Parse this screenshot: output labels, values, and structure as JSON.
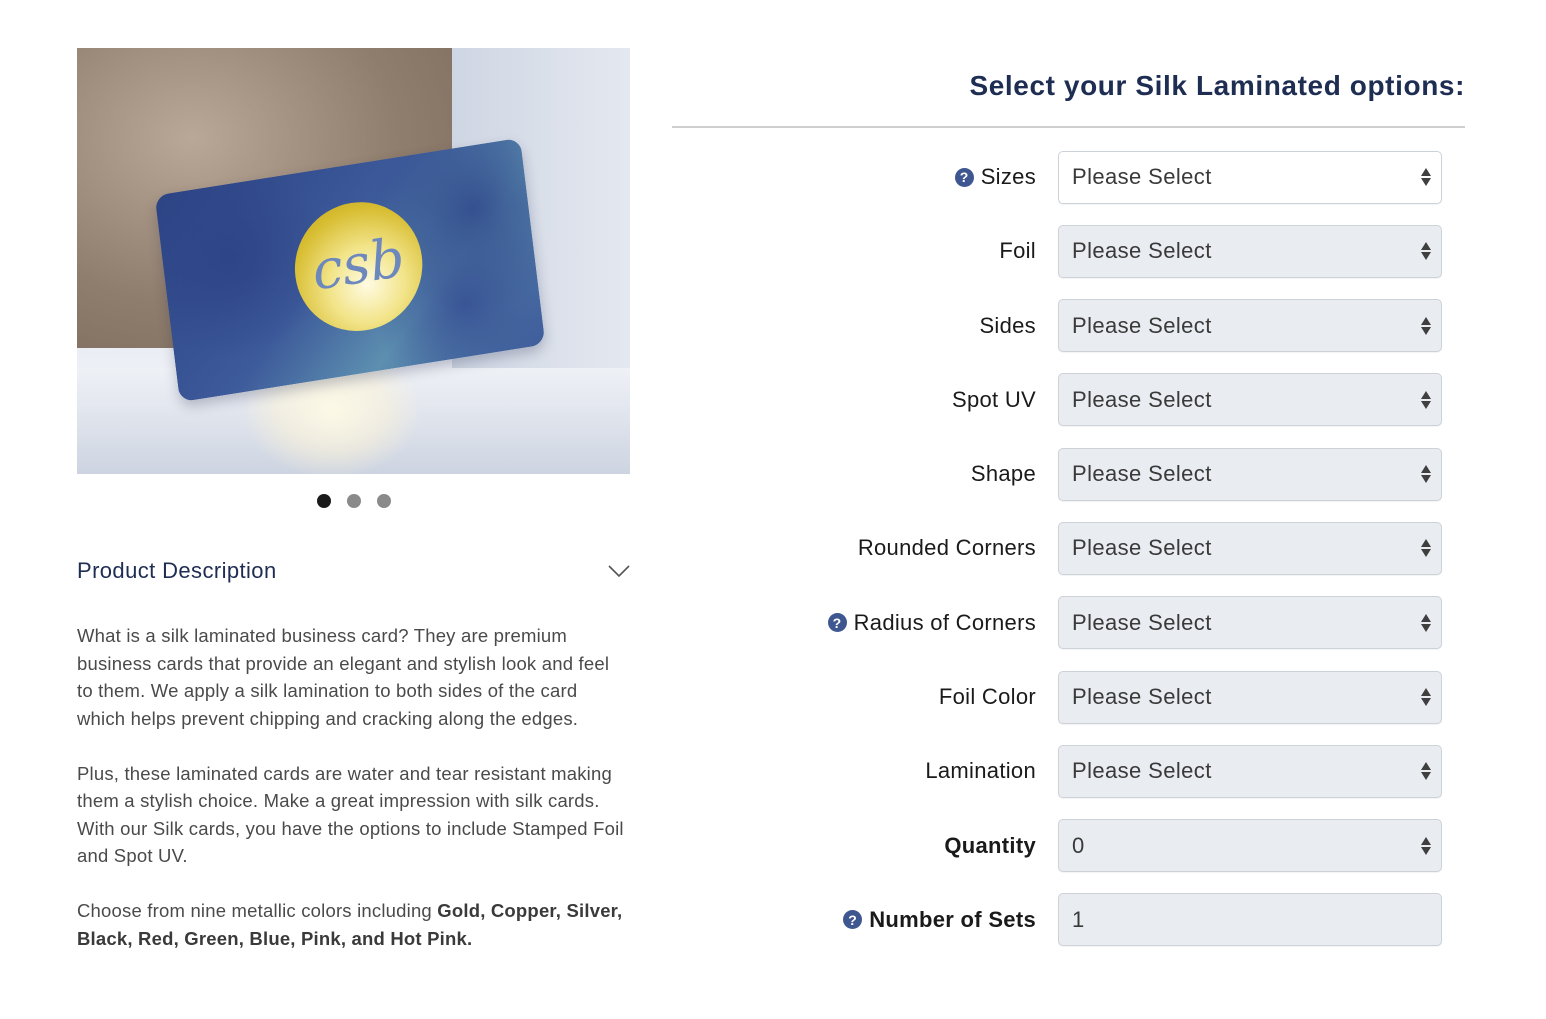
{
  "gallery": {
    "image_alt": "Silk laminated business card with gold foil monogram leaning against a stone pot",
    "monogram": "csb",
    "slide_count": 3,
    "active_slide": 1
  },
  "description": {
    "title": "Product Description",
    "expand_icon": "chevron-down-icon",
    "paragraph1": "What is a silk laminated business card? They are premium business cards that provide an elegant and stylish look and feel to them. We apply a silk lamination to both sides of the card which helps prevent chipping and cracking along the edges.",
    "paragraph2": "Plus, these laminated cards are water and tear resistant making them a stylish choice. Make a great impression with silk cards. With our Silk cards, you have the options to include Stamped Foil and Spot UV.",
    "paragraph3_prefix": "Choose from nine metallic colors including ",
    "paragraph3_bold": "Gold, Copper, Silver, Black, Red, Green, Blue, Pink, and Hot Pink."
  },
  "options": {
    "title": "Select your Silk Laminated options:",
    "help_glyph": "?",
    "fields": [
      {
        "label": "Sizes",
        "value": "Please Select",
        "help": true,
        "bold": false,
        "type": "select"
      },
      {
        "label": "Foil",
        "value": "Please Select",
        "help": false,
        "bold": false,
        "type": "select"
      },
      {
        "label": "Sides",
        "value": "Please Select",
        "help": false,
        "bold": false,
        "type": "select"
      },
      {
        "label": "Spot UV",
        "value": "Please Select",
        "help": false,
        "bold": false,
        "type": "select"
      },
      {
        "label": "Shape",
        "value": "Please Select",
        "help": false,
        "bold": false,
        "type": "select"
      },
      {
        "label": "Rounded Corners",
        "value": "Please Select",
        "help": false,
        "bold": false,
        "type": "select"
      },
      {
        "label": "Radius of Corners",
        "value": "Please Select",
        "help": true,
        "bold": false,
        "type": "select"
      },
      {
        "label": "Foil Color",
        "value": "Please Select",
        "help": false,
        "bold": false,
        "type": "select"
      },
      {
        "label": "Lamination",
        "value": "Please Select",
        "help": false,
        "bold": false,
        "type": "select"
      },
      {
        "label": "Quantity",
        "value": "0",
        "help": false,
        "bold": true,
        "type": "select"
      },
      {
        "label": "Number of Sets",
        "value": "1",
        "help": true,
        "bold": true,
        "type": "input"
      }
    ]
  },
  "colors": {
    "heading": "#1e2d52",
    "help_icon": "#3f5791",
    "field_bg": "#e9ecf0"
  }
}
